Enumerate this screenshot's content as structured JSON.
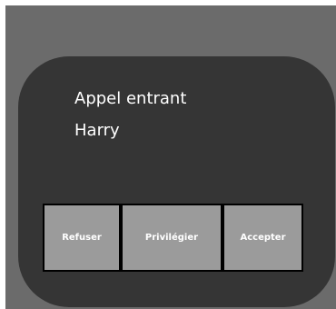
{
  "call": {
    "status": "Appel entrant",
    "caller": "Harry"
  },
  "softkeys": {
    "reject": "Refuser",
    "priority": "Privilégier",
    "accept": "Accepter"
  },
  "colors": {
    "frame": "#6b6b6b",
    "screen": "#353535",
    "softkey": "#9b9b9b",
    "softkey_border": "#000000",
    "text": "#ffffff"
  }
}
